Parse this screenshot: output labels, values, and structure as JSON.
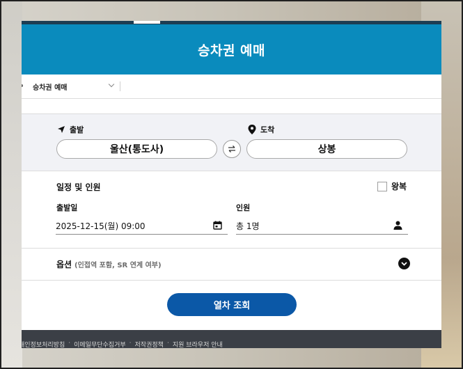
{
  "header": {
    "title": "승차권 예매"
  },
  "breadcrumb": {
    "current": "승차권 예매"
  },
  "route": {
    "departure_label": "출발",
    "departure_station": "울산(통도사)",
    "arrival_label": "도착",
    "arrival_station": "상봉"
  },
  "schedule": {
    "title": "일정 및 인원",
    "roundtrip_label": "왕복",
    "roundtrip_checked": false,
    "date_label": "출발일",
    "date_value": "2025-12-15(월) 09:00",
    "passengers_label": "인원",
    "passengers_value": "총 1명"
  },
  "options": {
    "title": "옵션",
    "subtitle": "(인접역 포함, SR 연계 여부)"
  },
  "search_button": "열차 조회",
  "footer": {
    "links": [
      "개인정보처리방침",
      "이메일무단수집거부",
      "저작권정책",
      "지원 브라우저 안내"
    ]
  },
  "colors": {
    "header_bg": "#0a8bbd",
    "button_bg": "#0b58a7",
    "footer_bg": "#3b3f46"
  }
}
